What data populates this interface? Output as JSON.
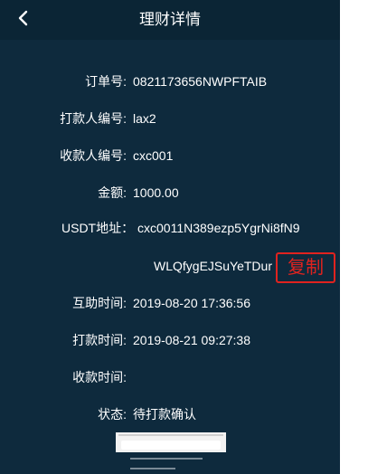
{
  "header": {
    "title": "理财详情",
    "back_icon": "chevron-left-icon"
  },
  "details": {
    "order_label": "订单号:",
    "order_value": "0821173656NWPFTAIB",
    "payer_label": "打款人编号:",
    "payer_value": "lax2",
    "payee_label": "收款人编号:",
    "payee_value": "cxc001",
    "amount_label": "金额:",
    "amount_value": "1000.00",
    "usdt_label": "USDT地址：",
    "usdt_value_line1": "cxc0011N389ezp5YgrNi8fN9",
    "usdt_value_line2": "WLQfygEJSuYeTDur",
    "copy_label": "复制",
    "help_time_label": "互助时间:",
    "help_time_value": "2019-08-20 17:36:56",
    "pay_time_label": "打款时间:",
    "pay_time_value": "2019-08-21 09:27:38",
    "receive_time_label": "收款时间:",
    "receive_time_value": "",
    "status_label": "状态:",
    "status_value": "待打款确认"
  },
  "colors": {
    "background": "#0e2a3d",
    "header": "#0b2535",
    "copy_accent": "#e0231f"
  }
}
